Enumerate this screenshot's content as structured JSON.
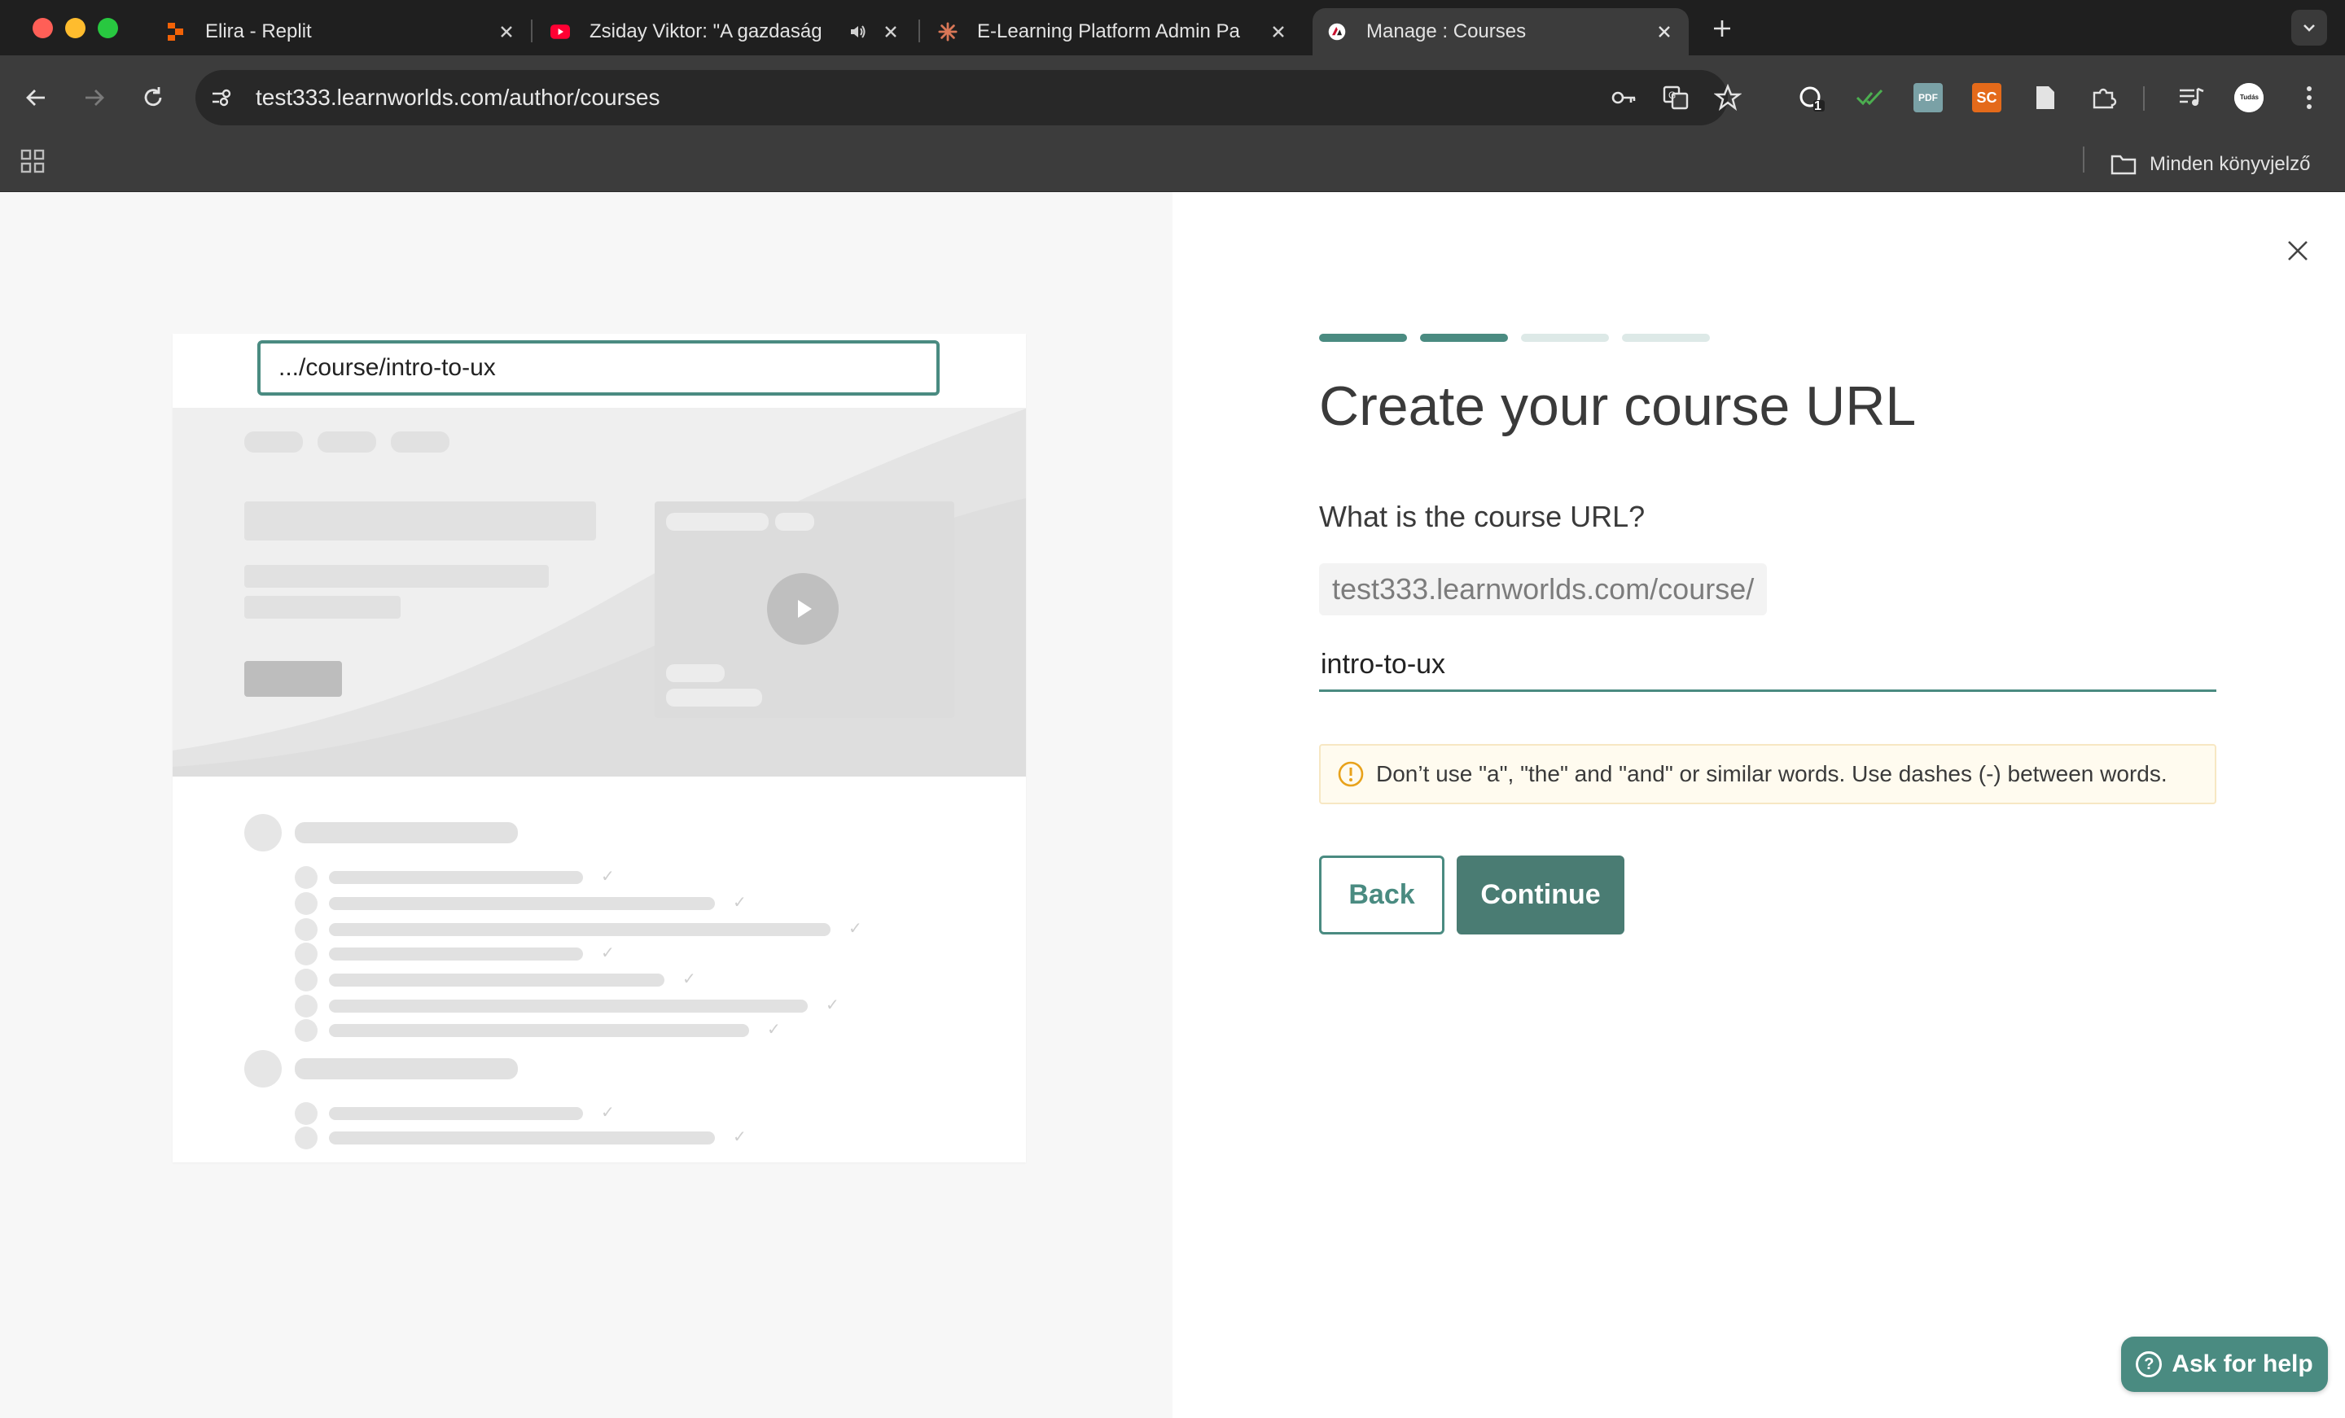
{
  "browser": {
    "tabs": [
      {
        "title": "Elira - Replit",
        "favicon": "replit-icon",
        "active": false
      },
      {
        "title": "Zsiday Viktor: \"A gazdaság",
        "favicon": "youtube-icon",
        "active": false
      },
      {
        "title": "E-Learning Platform Admin Pa",
        "favicon": "claude-icon",
        "active": false
      },
      {
        "title": "Manage : Courses",
        "favicon": "learnworlds-icon",
        "active": true
      }
    ],
    "url": "test333.learnworlds.com/author/courses",
    "bookmarks_all": "Minden könyvjelző",
    "extensions": [
      "pdf",
      "sc"
    ],
    "extension_badge": "1"
  },
  "preview": {
    "url_text": ".../course/intro-to-ux"
  },
  "wizard": {
    "step_total": 4,
    "step_current": 2,
    "heading": "Create your course URL",
    "question": "What is the course URL?",
    "url_prefix": "test333.learnworlds.com/course/",
    "url_value": "intro-to-ux",
    "notice": "Don’t use \"a\", \"the\" and \"and\" or similar words. Use dashes (-) between words.",
    "back_label": "Back",
    "continue_label": "Continue"
  },
  "help": {
    "label": "Ask for help"
  },
  "colors": {
    "accent": "#4a8b81",
    "continue_bg": "#4a7c73",
    "notice_bg": "#fffbef",
    "notice_icon": "#e8a21b"
  }
}
